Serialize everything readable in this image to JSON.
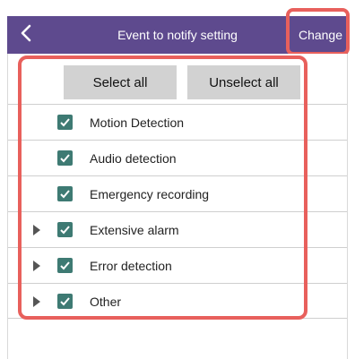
{
  "header": {
    "title": "Event to notify setting",
    "change_label": "Change",
    "back_icon": "chevron-left-icon",
    "color": "#5e4a8e"
  },
  "buttons": {
    "select_all": "Select all",
    "unselect_all": "Unselect all"
  },
  "events": [
    {
      "label": "Motion Detection",
      "checked": true,
      "expandable": false
    },
    {
      "label": "Audio detection",
      "checked": true,
      "expandable": false
    },
    {
      "label": "Emergency recording",
      "checked": true,
      "expandable": false
    },
    {
      "label": "Extensive alarm",
      "checked": true,
      "expandable": true
    },
    {
      "label": "Error detection",
      "checked": true,
      "expandable": true
    },
    {
      "label": "Other",
      "checked": true,
      "expandable": true
    }
  ],
  "colors": {
    "checkbox": "#3e7a73",
    "highlight": "#e8605c"
  }
}
